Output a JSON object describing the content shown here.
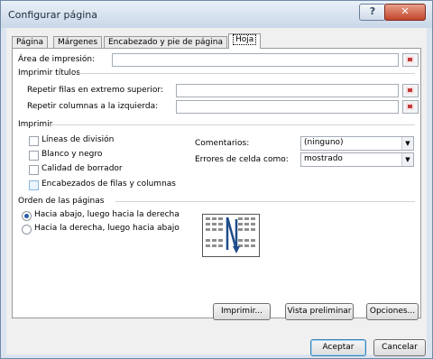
{
  "window": {
    "title": "Configurar página",
    "help_label": "?",
    "close_label": "✕"
  },
  "tabs": [
    {
      "label": "Página"
    },
    {
      "label": "Márgenes"
    },
    {
      "label": "Encabezado y pie de página"
    },
    {
      "label": "Hoja",
      "active": true
    }
  ],
  "print_area": {
    "label": "Área de impresión:",
    "value": ""
  },
  "print_titles": {
    "heading": "Imprimir títulos",
    "rows_label": "Repetir filas en extremo superior:",
    "rows_value": "",
    "cols_label": "Repetir columnas a la izquierda:",
    "cols_value": ""
  },
  "print": {
    "heading": "Imprimir",
    "checkboxes": [
      {
        "label": "Líneas de división",
        "checked": false
      },
      {
        "label": "Blanco y negro",
        "checked": false
      },
      {
        "label": "Calidad de borrador",
        "checked": false
      },
      {
        "label": "Encabezados de filas y columnas",
        "checked": false
      }
    ],
    "comments_label": "Comentarios:",
    "comments_value": "(ninguno)",
    "errors_label": "Errores de celda como:",
    "errors_value": "mostrado"
  },
  "page_order": {
    "heading": "Orden de las páginas",
    "options": [
      {
        "label": "Hacia abajo, luego hacia la derecha",
        "selected": true
      },
      {
        "label": "Hacia la derecha, luego hacia abajo",
        "selected": false
      }
    ]
  },
  "buttons": {
    "print": "Imprimir...",
    "preview": "Vista preliminar",
    "options": "Opciones...",
    "ok": "Aceptar",
    "cancel": "Cancelar"
  },
  "colors": {
    "title_bar": "#c9d7e8",
    "close_button": "#c2452a",
    "default_button_border": "#3c7fb1"
  }
}
